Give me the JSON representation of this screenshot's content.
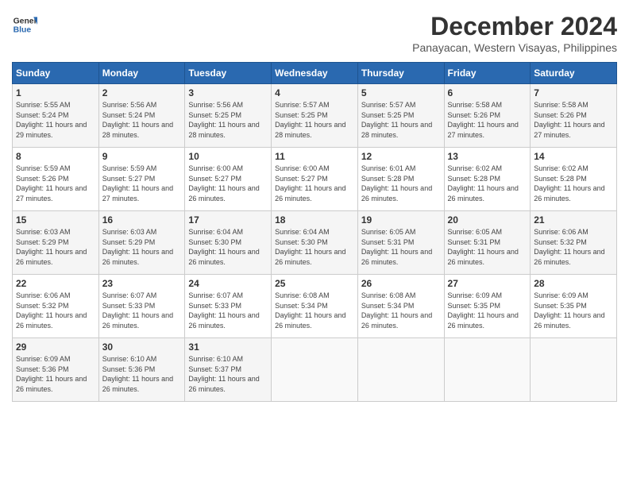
{
  "logo": {
    "line1": "General",
    "line2": "Blue"
  },
  "title": "December 2024",
  "location": "Panayacan, Western Visayas, Philippines",
  "headers": [
    "Sunday",
    "Monday",
    "Tuesday",
    "Wednesday",
    "Thursday",
    "Friday",
    "Saturday"
  ],
  "weeks": [
    [
      {
        "day": "1",
        "sunrise": "Sunrise: 5:55 AM",
        "sunset": "Sunset: 5:24 PM",
        "daylight": "Daylight: 11 hours and 29 minutes."
      },
      {
        "day": "2",
        "sunrise": "Sunrise: 5:56 AM",
        "sunset": "Sunset: 5:24 PM",
        "daylight": "Daylight: 11 hours and 28 minutes."
      },
      {
        "day": "3",
        "sunrise": "Sunrise: 5:56 AM",
        "sunset": "Sunset: 5:25 PM",
        "daylight": "Daylight: 11 hours and 28 minutes."
      },
      {
        "day": "4",
        "sunrise": "Sunrise: 5:57 AM",
        "sunset": "Sunset: 5:25 PM",
        "daylight": "Daylight: 11 hours and 28 minutes."
      },
      {
        "day": "5",
        "sunrise": "Sunrise: 5:57 AM",
        "sunset": "Sunset: 5:25 PM",
        "daylight": "Daylight: 11 hours and 28 minutes."
      },
      {
        "day": "6",
        "sunrise": "Sunrise: 5:58 AM",
        "sunset": "Sunset: 5:26 PM",
        "daylight": "Daylight: 11 hours and 27 minutes."
      },
      {
        "day": "7",
        "sunrise": "Sunrise: 5:58 AM",
        "sunset": "Sunset: 5:26 PM",
        "daylight": "Daylight: 11 hours and 27 minutes."
      }
    ],
    [
      {
        "day": "8",
        "sunrise": "Sunrise: 5:59 AM",
        "sunset": "Sunset: 5:26 PM",
        "daylight": "Daylight: 11 hours and 27 minutes."
      },
      {
        "day": "9",
        "sunrise": "Sunrise: 5:59 AM",
        "sunset": "Sunset: 5:27 PM",
        "daylight": "Daylight: 11 hours and 27 minutes."
      },
      {
        "day": "10",
        "sunrise": "Sunrise: 6:00 AM",
        "sunset": "Sunset: 5:27 PM",
        "daylight": "Daylight: 11 hours and 26 minutes."
      },
      {
        "day": "11",
        "sunrise": "Sunrise: 6:00 AM",
        "sunset": "Sunset: 5:27 PM",
        "daylight": "Daylight: 11 hours and 26 minutes."
      },
      {
        "day": "12",
        "sunrise": "Sunrise: 6:01 AM",
        "sunset": "Sunset: 5:28 PM",
        "daylight": "Daylight: 11 hours and 26 minutes."
      },
      {
        "day": "13",
        "sunrise": "Sunrise: 6:02 AM",
        "sunset": "Sunset: 5:28 PM",
        "daylight": "Daylight: 11 hours and 26 minutes."
      },
      {
        "day": "14",
        "sunrise": "Sunrise: 6:02 AM",
        "sunset": "Sunset: 5:28 PM",
        "daylight": "Daylight: 11 hours and 26 minutes."
      }
    ],
    [
      {
        "day": "15",
        "sunrise": "Sunrise: 6:03 AM",
        "sunset": "Sunset: 5:29 PM",
        "daylight": "Daylight: 11 hours and 26 minutes."
      },
      {
        "day": "16",
        "sunrise": "Sunrise: 6:03 AM",
        "sunset": "Sunset: 5:29 PM",
        "daylight": "Daylight: 11 hours and 26 minutes."
      },
      {
        "day": "17",
        "sunrise": "Sunrise: 6:04 AM",
        "sunset": "Sunset: 5:30 PM",
        "daylight": "Daylight: 11 hours and 26 minutes."
      },
      {
        "day": "18",
        "sunrise": "Sunrise: 6:04 AM",
        "sunset": "Sunset: 5:30 PM",
        "daylight": "Daylight: 11 hours and 26 minutes."
      },
      {
        "day": "19",
        "sunrise": "Sunrise: 6:05 AM",
        "sunset": "Sunset: 5:31 PM",
        "daylight": "Daylight: 11 hours and 26 minutes."
      },
      {
        "day": "20",
        "sunrise": "Sunrise: 6:05 AM",
        "sunset": "Sunset: 5:31 PM",
        "daylight": "Daylight: 11 hours and 26 minutes."
      },
      {
        "day": "21",
        "sunrise": "Sunrise: 6:06 AM",
        "sunset": "Sunset: 5:32 PM",
        "daylight": "Daylight: 11 hours and 26 minutes."
      }
    ],
    [
      {
        "day": "22",
        "sunrise": "Sunrise: 6:06 AM",
        "sunset": "Sunset: 5:32 PM",
        "daylight": "Daylight: 11 hours and 26 minutes."
      },
      {
        "day": "23",
        "sunrise": "Sunrise: 6:07 AM",
        "sunset": "Sunset: 5:33 PM",
        "daylight": "Daylight: 11 hours and 26 minutes."
      },
      {
        "day": "24",
        "sunrise": "Sunrise: 6:07 AM",
        "sunset": "Sunset: 5:33 PM",
        "daylight": "Daylight: 11 hours and 26 minutes."
      },
      {
        "day": "25",
        "sunrise": "Sunrise: 6:08 AM",
        "sunset": "Sunset: 5:34 PM",
        "daylight": "Daylight: 11 hours and 26 minutes."
      },
      {
        "day": "26",
        "sunrise": "Sunrise: 6:08 AM",
        "sunset": "Sunset: 5:34 PM",
        "daylight": "Daylight: 11 hours and 26 minutes."
      },
      {
        "day": "27",
        "sunrise": "Sunrise: 6:09 AM",
        "sunset": "Sunset: 5:35 PM",
        "daylight": "Daylight: 11 hours and 26 minutes."
      },
      {
        "day": "28",
        "sunrise": "Sunrise: 6:09 AM",
        "sunset": "Sunset: 5:35 PM",
        "daylight": "Daylight: 11 hours and 26 minutes."
      }
    ],
    [
      {
        "day": "29",
        "sunrise": "Sunrise: 6:09 AM",
        "sunset": "Sunset: 5:36 PM",
        "daylight": "Daylight: 11 hours and 26 minutes."
      },
      {
        "day": "30",
        "sunrise": "Sunrise: 6:10 AM",
        "sunset": "Sunset: 5:36 PM",
        "daylight": "Daylight: 11 hours and 26 minutes."
      },
      {
        "day": "31",
        "sunrise": "Sunrise: 6:10 AM",
        "sunset": "Sunset: 5:37 PM",
        "daylight": "Daylight: 11 hours and 26 minutes."
      },
      null,
      null,
      null,
      null
    ]
  ]
}
